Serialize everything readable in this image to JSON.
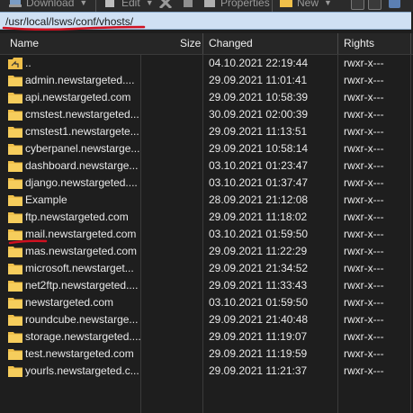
{
  "toolbar": {
    "download_label": "Download",
    "edit_label": "Edit",
    "properties_label": "Properties",
    "new_label": "New"
  },
  "path": {
    "current": "/usr/local/lsws/conf/vhosts/"
  },
  "columns": {
    "name": "Name",
    "size": "Size",
    "changed": "Changed",
    "rights": "Rights"
  },
  "colors": {
    "folder": "#f0c04a",
    "annotation": "#d01020",
    "path_bg": "#cfe0f3"
  },
  "files": [
    {
      "name": "..",
      "changed": "04.10.2021 22:19:44",
      "rights": "rwxr-x---",
      "icon": "parent-folder-icon"
    },
    {
      "name": "admin.newstargeted....",
      "changed": "29.09.2021 11:01:41",
      "rights": "rwxr-x---",
      "icon": "folder-icon"
    },
    {
      "name": "api.newstargeted.com",
      "changed": "29.09.2021 10:58:39",
      "rights": "rwxr-x---",
      "icon": "folder-icon"
    },
    {
      "name": "cmstest.newstargeted...",
      "changed": "30.09.2021 02:00:39",
      "rights": "rwxr-x---",
      "icon": "folder-icon"
    },
    {
      "name": "cmstest1.newstargete...",
      "changed": "29.09.2021 11:13:51",
      "rights": "rwxr-x---",
      "icon": "folder-icon"
    },
    {
      "name": "cyberpanel.newstarge...",
      "changed": "29.09.2021 10:58:14",
      "rights": "rwxr-x---",
      "icon": "folder-icon"
    },
    {
      "name": "dashboard.newstarge...",
      "changed": "03.10.2021 01:23:47",
      "rights": "rwxr-x---",
      "icon": "folder-icon"
    },
    {
      "name": "django.newstargeted....",
      "changed": "03.10.2021 01:37:47",
      "rights": "rwxr-x---",
      "icon": "folder-icon"
    },
    {
      "name": "Example",
      "changed": "28.09.2021 21:12:08",
      "rights": "rwxr-x---",
      "icon": "folder-icon"
    },
    {
      "name": "ftp.newstargeted.com",
      "changed": "29.09.2021 11:18:02",
      "rights": "rwxr-x---",
      "icon": "folder-icon"
    },
    {
      "name": "mail.newstargeted.com",
      "changed": "03.10.2021 01:59:50",
      "rights": "rwxr-x---",
      "icon": "folder-icon"
    },
    {
      "name": "mas.newstargeted.com",
      "changed": "29.09.2021 11:22:29",
      "rights": "rwxr-x---",
      "icon": "folder-icon"
    },
    {
      "name": "microsoft.newstarget...",
      "changed": "29.09.2021 21:34:52",
      "rights": "rwxr-x---",
      "icon": "folder-icon"
    },
    {
      "name": "net2ftp.newstargeted....",
      "changed": "29.09.2021 11:33:43",
      "rights": "rwxr-x---",
      "icon": "folder-icon"
    },
    {
      "name": "newstargeted.com",
      "changed": "03.10.2021 01:59:50",
      "rights": "rwxr-x---",
      "icon": "folder-icon"
    },
    {
      "name": "roundcube.newstarge...",
      "changed": "29.09.2021 21:40:48",
      "rights": "rwxr-x---",
      "icon": "folder-icon"
    },
    {
      "name": "storage.newstargeted....",
      "changed": "29.09.2021 11:19:07",
      "rights": "rwxr-x---",
      "icon": "folder-icon"
    },
    {
      "name": "test.newstargeted.com",
      "changed": "29.09.2021 11:19:59",
      "rights": "rwxr-x---",
      "icon": "folder-icon"
    },
    {
      "name": "yourls.newstargeted.c...",
      "changed": "29.09.2021 11:21:37",
      "rights": "rwxr-x---",
      "icon": "folder-icon"
    }
  ]
}
